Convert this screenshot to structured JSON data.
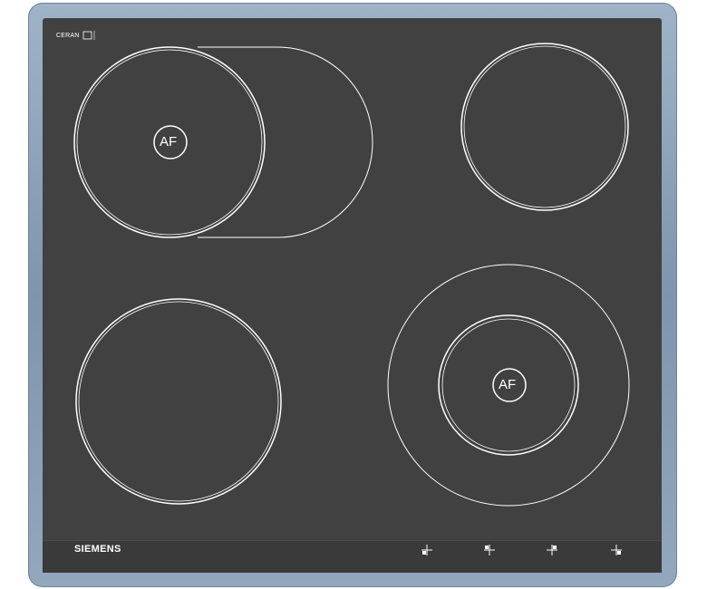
{
  "hob": {
    "top_marking": "CERAN",
    "brand": "SIEMENS",
    "zone_markers": [
      "AF",
      "AF"
    ],
    "control_indicators": [
      "front-left",
      "rear-left",
      "rear-right",
      "front-right"
    ],
    "colors": {
      "glass": "#414141",
      "frame": "#8ea2b8",
      "ring_lines": "#ffffff"
    }
  }
}
